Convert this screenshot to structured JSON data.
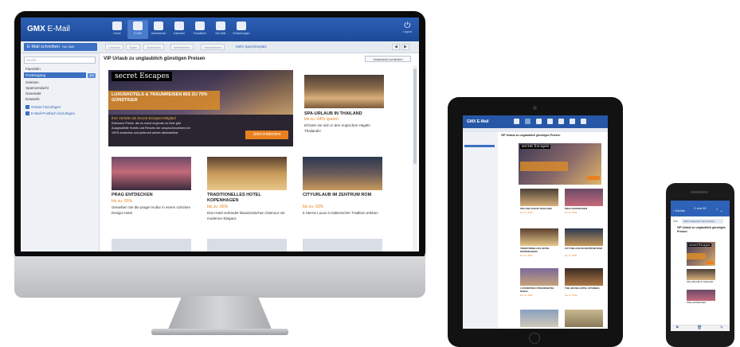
{
  "colors": {
    "brand_blue": "#1d4a98",
    "accent_orange": "#e8801f",
    "hero_band": "#dc8c28"
  },
  "desktop": {
    "logo_bold": "GMX",
    "logo_rest": " E-Mail",
    "nav": [
      {
        "icon": "home-icon",
        "label": "Home"
      },
      {
        "icon": "mail-icon",
        "label": "E-Mail"
      },
      {
        "icon": "addressbook-icon",
        "label": "Adressbuch"
      },
      {
        "icon": "calendar-icon",
        "label": "Kalender"
      },
      {
        "icon": "photos-icon",
        "label": "Fotoalbum"
      },
      {
        "icon": "file-icon",
        "label": "Die Akte"
      },
      {
        "icon": "settings-icon",
        "label": "Einstellungen"
      }
    ],
    "logout_label": "Logout",
    "compose_label": "E-Mail schreiben",
    "compose_extra": "FAX SMS",
    "toolbar_buttons": [
      "Löschen",
      "Spam",
      "Antworten",
      "Weiterleiten",
      "Verschieben"
    ],
    "toolbar_link": "Mehr Speicherplatz",
    "search_placeholder": "Suche",
    "folders": [
      "Favoriten",
      "Posteingang",
      "Gelesen",
      "Spamverdacht",
      "Gesendet",
      "Entwürfe"
    ],
    "inbox_count": "100",
    "sidebar_actions": [
      "Ordner hinzufügen",
      "E-Mail-Postfach hinzufügen"
    ],
    "message_title": "VIP Urlaub zu unglaublich günstigen Preisen",
    "close_label": "Vollansicht schließen",
    "hero": {
      "logo": "secret Escapes",
      "headline": "LUXUSHOTELS & TRAUMREISEN BIS ZU 70% GÜNSTIGER",
      "subline": "Ihre Vorteile als Secret Escapes-Mitglied",
      "bullets": [
        "Exklusive Preise, die es sonst nirgends im Netz gibt",
        "Ausgewählte Hotels und Resorts der anspruchsvollsten Art",
        "100% kostenlos und jederzeit wieder abbestellbar"
      ],
      "cta": "Jetzt entdecken"
    },
    "offers": [
      {
        "title": "SPA-URLAUB IN THAILAND",
        "price": "bis zu -64% sparen",
        "desc": "Erholen sie sich in den tropischen Hügeln Thailands!"
      },
      {
        "title": "PRAG ENTDECKEN",
        "price": "bis zu -55%",
        "desc": "Genießen Sie die prager Kultur in einem schicken Design-Hotel"
      },
      {
        "title": "TRADITIONELLES HOTEL KOPENHAGEN",
        "price": "bis zu -56%",
        "desc": "Das Hotel verbindet klassizistischen Glamour mit moderner Eleganz"
      },
      {
        "title": "CITYURLAUB IM ZENTRUM ROM",
        "price": "bis zu -63%",
        "desc": "5 Sterne Luxus in italienischer Tradition erleben"
      }
    ]
  },
  "tablet": {
    "logo": "GMX E-Mail",
    "title": "VIP Urlaub zu unglaublich günstigen Preisen",
    "hero_logo": "secret Escapes",
    "offers": [
      {
        "title": "SPA-URLAUB IN THAILAND",
        "price": "bis zu -64%"
      },
      {
        "title": "PRAG ENTDECKEN",
        "price": "bis zu -55%"
      },
      {
        "title": "TRADITIONELLES HOTEL KOPENHAGEN",
        "price": "bis zu -56%"
      },
      {
        "title": "CITYURLAUB IM ZENTRUM ROM",
        "price": "bis zu -63%"
      },
      {
        "title": "LUXURIÖSES STRANDHOTEL DUBAI",
        "price": "bis zu -54%"
      },
      {
        "title": "THE HOUSE HOTEL ISTANBUL",
        "price": "bis zu -51%"
      }
    ]
  },
  "phone": {
    "back_label": "Zurück",
    "count_label": "2 von 91",
    "from_label": "Von",
    "from_value": "GMX präsentiert Secret Esca...",
    "subject": "VIP Urlaub zu unglaublich günstigen Preisen",
    "hero_logo": "secret Escapes",
    "captions": [
      "SPA-URLAUB IN THAILAND",
      "PRAG ENTDECKEN"
    ]
  }
}
